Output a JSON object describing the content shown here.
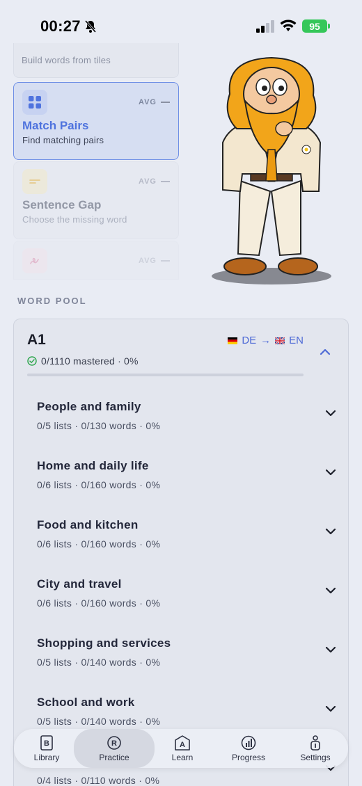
{
  "status_bar": {
    "time": "00:27",
    "battery": "95"
  },
  "modes": [
    {
      "subtitle": "Build words from tiles"
    },
    {
      "title": "Match Pairs",
      "subtitle": "Find matching pairs",
      "badge": "AVG",
      "icon": "grid-icon",
      "active": true
    },
    {
      "title": "Sentence Gap",
      "subtitle": "Choose the missing word",
      "badge": "AVG",
      "icon": "text-gap-icon"
    },
    {
      "badge": "AVG",
      "icon": "squiggle-icon"
    }
  ],
  "word_pool": {
    "section_label": "WORD POOL",
    "level": "A1",
    "source_lang": "DE",
    "target_lang": "EN",
    "arrow": "→",
    "mastered": "0/1110 mastered · 0%",
    "progress_fraction": 0,
    "topics": [
      {
        "title": "People and family",
        "stats": "0/5 lists · 0/130 words · 0%"
      },
      {
        "title": "Home and daily life",
        "stats": "0/6 lists · 0/160 words · 0%"
      },
      {
        "title": "Food and kitchen",
        "stats": "0/6 lists · 0/160 words · 0%"
      },
      {
        "title": "City and travel",
        "stats": "0/6 lists · 0/160 words · 0%"
      },
      {
        "title": "Shopping and services",
        "stats": "0/5 lists · 0/140 words · 0%"
      },
      {
        "title": "School and work",
        "stats": "0/5 lists · 0/140 words · 0%"
      },
      {
        "title": "",
        "stats": "0/4 lists · 0/110 words · 0%"
      }
    ]
  },
  "nav": [
    {
      "label": "Library",
      "icon": "book-icon"
    },
    {
      "label": "Practice",
      "icon": "practice-icon",
      "active": true
    },
    {
      "label": "Learn",
      "icon": "learn-icon"
    },
    {
      "label": "Progress",
      "icon": "progress-icon"
    },
    {
      "label": "Settings",
      "icon": "settings-icon"
    }
  ]
}
